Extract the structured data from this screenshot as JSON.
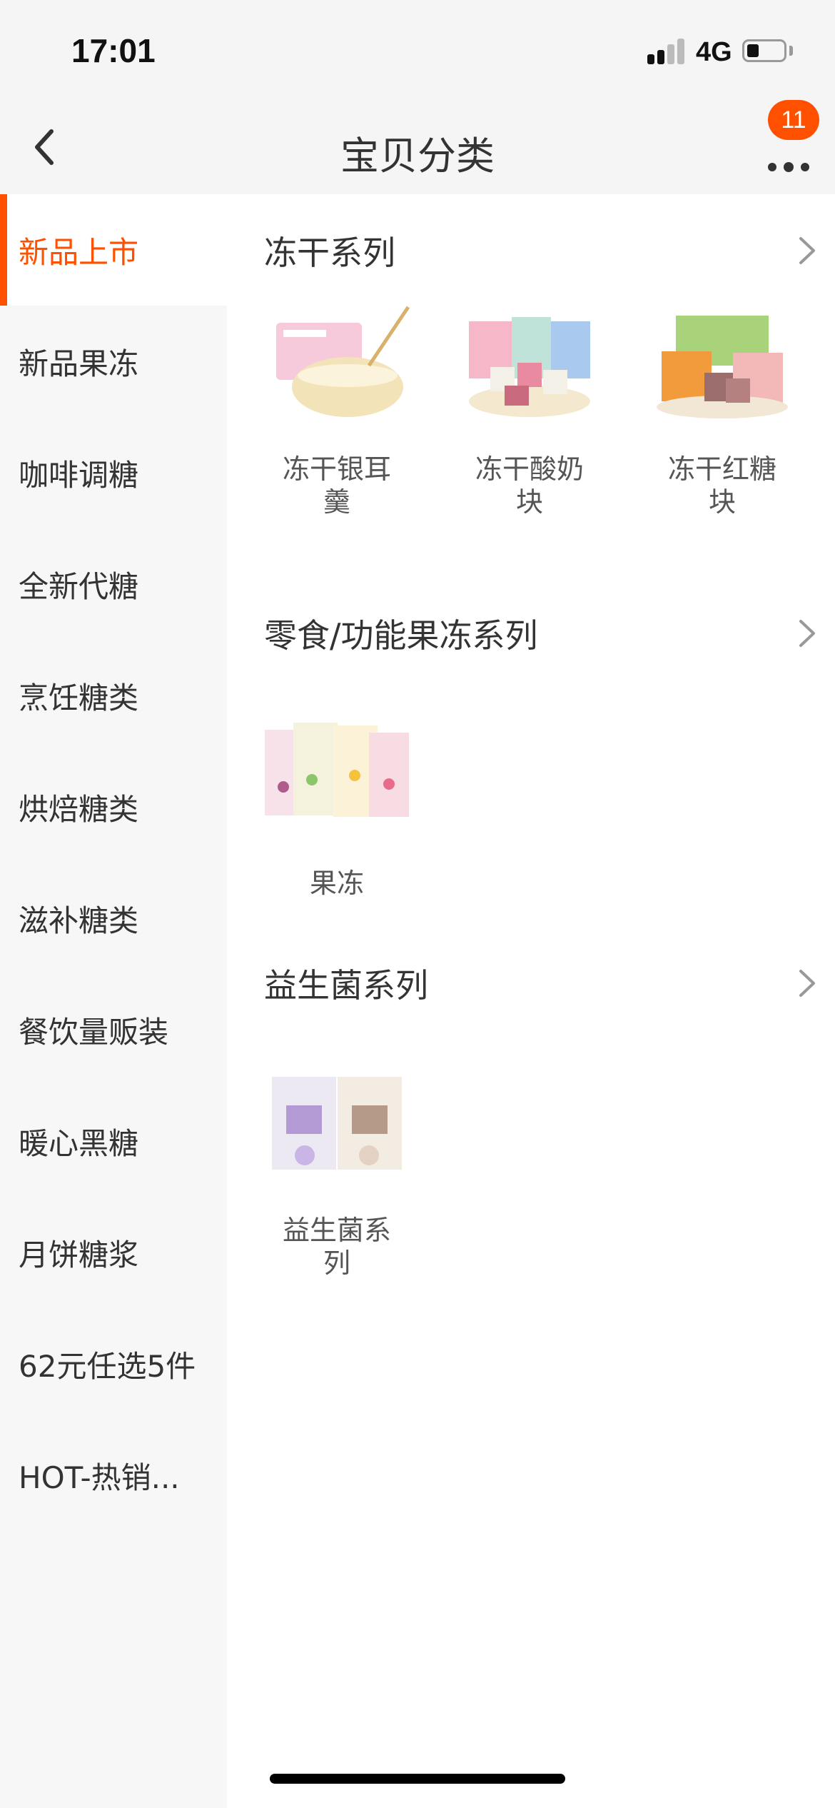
{
  "status_bar": {
    "time": "17:01",
    "network": "4G"
  },
  "nav": {
    "title": "宝贝分类",
    "badge_count": "11"
  },
  "sidebar": {
    "items": [
      {
        "label": "新品上市",
        "active": true
      },
      {
        "label": "新品果冻"
      },
      {
        "label": "咖啡调糖"
      },
      {
        "label": "全新代糖"
      },
      {
        "label": "烹饪糖类"
      },
      {
        "label": "烘焙糖类"
      },
      {
        "label": "滋补糖类"
      },
      {
        "label": "餐饮量贩装"
      },
      {
        "label": "暖心黑糖"
      },
      {
        "label": "月饼糖浆"
      },
      {
        "label": "62元任选5件"
      },
      {
        "label": "HOT-热销..."
      }
    ]
  },
  "sections": [
    {
      "title": "冻干系列",
      "products": [
        {
          "name": "冻干银耳羹"
        },
        {
          "name": "冻干酸奶块"
        },
        {
          "name": "冻干红糖块"
        }
      ]
    },
    {
      "title": "零食/功能果冻系列",
      "products": [
        {
          "name": "果冻"
        }
      ]
    },
    {
      "title": "益生菌系列",
      "products": [
        {
          "name": "益生菌系列"
        }
      ]
    }
  ],
  "colors": {
    "accent": "#ff5000",
    "sidebar_bg": "#f7f7f7",
    "main_bg": "#ffffff"
  }
}
